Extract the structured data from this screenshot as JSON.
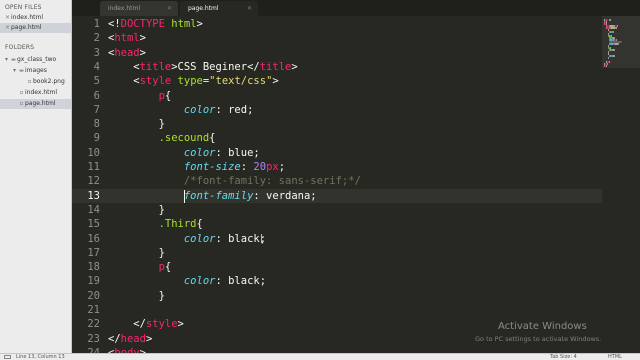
{
  "sidebar": {
    "open_files_header": "OPEN FILES",
    "open_files": [
      {
        "name": "index.html",
        "selected": false
      },
      {
        "name": "page.html",
        "selected": true
      }
    ],
    "folders_header": "FOLDERS",
    "tree": [
      {
        "name": "gx_class_two",
        "kind": "folder",
        "depth": 0,
        "selected": false
      },
      {
        "name": "images",
        "kind": "folder",
        "depth": 1,
        "selected": false
      },
      {
        "name": "book2.png",
        "kind": "file",
        "depth": 2,
        "selected": false
      },
      {
        "name": "index.html",
        "kind": "file",
        "depth": 1,
        "selected": false
      },
      {
        "name": "page.html",
        "kind": "file",
        "depth": 1,
        "selected": true
      }
    ]
  },
  "tabs": [
    {
      "label": "index.html",
      "active": false
    },
    {
      "label": "page.html",
      "active": true
    }
  ],
  "editor": {
    "current_line": 13,
    "lines": [
      {
        "n": "1",
        "tokens": [
          [
            "plain",
            "<!"
          ],
          [
            "tag",
            "DOCTYPE"
          ],
          [
            "plain",
            " "
          ],
          [
            "attr",
            "html"
          ],
          [
            "plain",
            ">"
          ]
        ]
      },
      {
        "n": "2",
        "tokens": [
          [
            "plain",
            "<"
          ],
          [
            "tag",
            "html"
          ],
          [
            "plain",
            ">"
          ]
        ]
      },
      {
        "n": "3",
        "tokens": [
          [
            "plain",
            "<"
          ],
          [
            "tag",
            "head"
          ],
          [
            "plain",
            ">"
          ]
        ]
      },
      {
        "n": "4",
        "tokens": [
          [
            "plain",
            "    <"
          ],
          [
            "tag",
            "title"
          ],
          [
            "plain",
            ">CSS Beginer</"
          ],
          [
            "tag",
            "title"
          ],
          [
            "plain",
            ">"
          ]
        ]
      },
      {
        "n": "5",
        "tokens": [
          [
            "plain",
            "    <"
          ],
          [
            "tag",
            "style"
          ],
          [
            "plain",
            " "
          ],
          [
            "attr",
            "type"
          ],
          [
            "plain",
            "="
          ],
          [
            "str",
            "\"text/css\""
          ],
          [
            "plain",
            ">"
          ]
        ]
      },
      {
        "n": "6",
        "tokens": [
          [
            "plain",
            "        "
          ],
          [
            "tag",
            "p"
          ],
          [
            "plain",
            "{"
          ]
        ]
      },
      {
        "n": "7",
        "tokens": [
          [
            "plain",
            "            "
          ],
          [
            "prop",
            "color"
          ],
          [
            "plain",
            ": red;"
          ]
        ]
      },
      {
        "n": "8",
        "tokens": [
          [
            "plain",
            "        }"
          ]
        ]
      },
      {
        "n": "9",
        "tokens": [
          [
            "plain",
            "        "
          ],
          [
            "sel",
            ".secound"
          ],
          [
            "plain",
            "{"
          ]
        ]
      },
      {
        "n": "10",
        "tokens": [
          [
            "plain",
            "            "
          ],
          [
            "prop",
            "color"
          ],
          [
            "plain",
            ": blue;"
          ]
        ]
      },
      {
        "n": "11",
        "tokens": [
          [
            "plain",
            "            "
          ],
          [
            "prop",
            "font-size"
          ],
          [
            "plain",
            ": "
          ],
          [
            "num",
            "20"
          ],
          [
            "tag",
            "px"
          ],
          [
            "plain",
            ";"
          ]
        ]
      },
      {
        "n": "12",
        "tokens": [
          [
            "plain",
            "            "
          ],
          [
            "cmt",
            "/*font-family: sans-serif;*/"
          ]
        ]
      },
      {
        "n": "13",
        "tokens": [
          [
            "plain",
            "            "
          ],
          [
            "prop",
            "font-family"
          ],
          [
            "plain",
            ": verdana;"
          ]
        ]
      },
      {
        "n": "14",
        "tokens": [
          [
            "plain",
            "        }"
          ]
        ]
      },
      {
        "n": "15",
        "tokens": [
          [
            "plain",
            "        "
          ],
          [
            "sel",
            ".Third"
          ],
          [
            "plain",
            "{"
          ]
        ]
      },
      {
        "n": "16",
        "tokens": [
          [
            "plain",
            "            "
          ],
          [
            "prop",
            "color"
          ],
          [
            "plain",
            ": black;"
          ]
        ]
      },
      {
        "n": "17",
        "tokens": [
          [
            "plain",
            "        }"
          ]
        ]
      },
      {
        "n": "18",
        "tokens": [
          [
            "plain",
            "        "
          ],
          [
            "tag",
            "p"
          ],
          [
            "plain",
            "{"
          ]
        ]
      },
      {
        "n": "19",
        "tokens": [
          [
            "plain",
            "            "
          ],
          [
            "prop",
            "color"
          ],
          [
            "plain",
            ": black;"
          ]
        ]
      },
      {
        "n": "20",
        "tokens": [
          [
            "plain",
            "        }"
          ]
        ]
      },
      {
        "n": "21",
        "tokens": []
      },
      {
        "n": "22",
        "tokens": [
          [
            "plain",
            "    </"
          ],
          [
            "tag",
            "style"
          ],
          [
            "plain",
            ">"
          ]
        ]
      },
      {
        "n": "23",
        "tokens": [
          [
            "plain",
            "</"
          ],
          [
            "tag",
            "head"
          ],
          [
            "plain",
            ">"
          ]
        ]
      },
      {
        "n": "24",
        "tokens": [
          [
            "plain",
            "<"
          ],
          [
            "tag",
            "body"
          ],
          [
            "plain",
            ">"
          ]
        ]
      }
    ]
  },
  "watermark": {
    "title": "Activate Windows",
    "subtitle": "Go to PC settings to activate Windows."
  },
  "status_bar": {
    "position": "Line 13, Column 13",
    "tab_size": "Tab Size: 4",
    "syntax": "HTML"
  },
  "colors": {
    "background": "#272822",
    "tag": "#f92672",
    "attribute": "#a6e22e",
    "string": "#e6db74",
    "property": "#66d9ef",
    "number": "#ae81ff",
    "comment": "#75715e"
  },
  "icons": [
    "close-icon",
    "folder-icon",
    "file-icon",
    "disclosure-triangle-icon",
    "panel-toggle-icon"
  ]
}
